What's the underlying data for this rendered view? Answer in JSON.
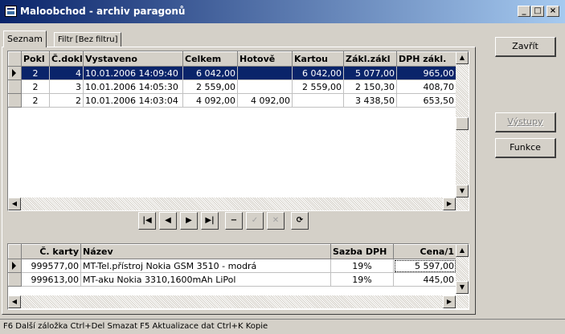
{
  "window": {
    "title": "Maloobchod - archiv paragonů",
    "min": "_",
    "max": "□",
    "close": "×"
  },
  "tabs": [
    {
      "label": "Seznam"
    },
    {
      "label": "Filtr [Bez filtru]"
    }
  ],
  "top_grid": {
    "columns": [
      "Pokl",
      "Č.dokl",
      "Vystaveno",
      "Celkem",
      "Hotově",
      "Kartou",
      "Zákl.zákl",
      "DPH zákl."
    ],
    "rows": [
      {
        "pokl": "2",
        "dokl": "4",
        "vystaveno": "10.01.2006 14:09:40",
        "celkem": "6 042,00",
        "hotove": "",
        "kartou": "6 042,00",
        "zakl": "5 077,00",
        "dph": "965,00"
      },
      {
        "pokl": "2",
        "dokl": "3",
        "vystaveno": "10.01.2006 14:05:30",
        "celkem": "2 559,00",
        "hotove": "",
        "kartou": "2 559,00",
        "zakl": "2 150,30",
        "dph": "408,70"
      },
      {
        "pokl": "2",
        "dokl": "2",
        "vystaveno": "10.01.2006 14:03:04",
        "celkem": "4 092,00",
        "hotove": "4 092,00",
        "kartou": "",
        "zakl": "3 438,50",
        "dph": "653,50"
      }
    ]
  },
  "navigator": {
    "first": "|◀",
    "prior": "◀",
    "next": "▶",
    "last": "▶|",
    "delete": "−",
    "post": "✓",
    "cancel": "✕",
    "refresh": "⟳"
  },
  "bottom_grid": {
    "columns": [
      "Č. karty",
      "Název",
      "Sazba DPH",
      "Cena/1"
    ],
    "rows": [
      {
        "karta": "999577,00",
        "nazev": "MT-Tel.přístroj Nokia GSM 3510 - modrá",
        "sazba": "19%",
        "cena": "5 597,00"
      },
      {
        "karta": "999613,00",
        "nazev": "MT-aku Nokia 3310,1600mAh LiPol",
        "sazba": "19%",
        "cena": "445,00"
      }
    ]
  },
  "buttons": {
    "close": "Zavřít",
    "outputs": "Výstupy",
    "functions": "Funkce"
  },
  "statusbar": "F6 Další záložka  Ctrl+Del Smazat  F5 Aktualizace dat  Ctrl+K Kopie"
}
